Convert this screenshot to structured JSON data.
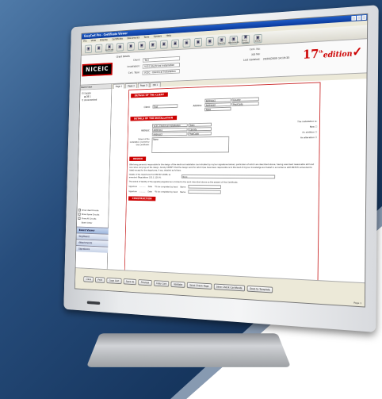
{
  "app": {
    "title": "EasyCert Pro - Certificate Viewer",
    "menu": [
      "File",
      "View",
      "Display",
      "Certificate",
      "Documents",
      "Tools",
      "System",
      "Help"
    ],
    "toolbar": [
      {
        "label": "",
        "icon": "new-icon"
      },
      {
        "label": "",
        "icon": "open-icon"
      },
      {
        "label": "Certificate",
        "icon": "certificate-icon"
      },
      {
        "label": "",
        "icon": "print-icon"
      },
      {
        "label": "",
        "icon": "copy-icon"
      },
      {
        "label": "",
        "icon": "paste-icon"
      },
      {
        "label": "",
        "icon": "doc-icon"
      },
      {
        "label": "",
        "icon": "doc-icon"
      },
      {
        "label": "",
        "icon": "doc-icon"
      },
      {
        "label": "",
        "icon": "doc-icon"
      },
      {
        "label": "",
        "icon": "doc-icon"
      },
      {
        "label": "",
        "icon": "doc-icon"
      },
      {
        "label": "Reports",
        "icon": "reports-icon"
      },
      {
        "label": "Attachments",
        "icon": "attachments-icon"
      },
      {
        "label": "Email Update",
        "icon": "email-icon"
      },
      {
        "label": "NICEIC",
        "icon": "niceic-icon"
      }
    ]
  },
  "header": {
    "logo": "NICEIC",
    "client_details_label": "Client Details",
    "client_label": "Client:",
    "client": "Test",
    "installation_label": "Installation:",
    "installation": "VCEC Electrical Installation",
    "cert_type_label": "Cert. Type:",
    "cert_type": "VCEC - Electrical Installation",
    "cert_no_label": "Cert. No:",
    "cert_no": "",
    "job_no_label": "Job No:",
    "job_no": "",
    "last_updated_label": "Last Updated:",
    "last_updated": "20/04/2009 14:19:35",
    "edition_num": "17",
    "edition_sup": "th",
    "edition_word": "edition"
  },
  "sidebar": {
    "title": "Board View",
    "tree": [
      "Supply",
      "DB 1",
      "Unconnected"
    ],
    "checks": [
      "Show Used Circuits",
      "Show Spare Circuits",
      "Show All Circuits",
      "Board Order"
    ],
    "nav": [
      "Board Viewer",
      "Key/Board",
      "Attachments",
      "Signatures"
    ]
  },
  "tabs": [
    "Page 1",
    "Page 2",
    "Page 3",
    "DB 1"
  ],
  "form": {
    "sec_client": "DETAILS OF THE CLIENT",
    "client_lbl": "Client:",
    "client_val": "Test",
    "address_lbl": "Address:",
    "addr1": "Address1",
    "addr2": "Address2",
    "town": "Town",
    "county": "County",
    "postcode": "PostCode",
    "sec_install": "DETAILS OF THE INSTALLATION",
    "i_address_lbl": "Address:",
    "i_val1": "VCEC Electrical Installation",
    "i_addr1": "Address1",
    "i_addr2": "Address2",
    "i_town": "Town",
    "i_county": "County",
    "i_postcode": "PostCode",
    "extent_lbl": "Extent of the installation covered by this Certificate:",
    "extent_val": "None",
    "install_is": "The installation is:",
    "new": "New",
    "addition": "An addition",
    "alteration": "An alteration",
    "sec_design": "DESIGN",
    "design_text": "I/We being person(s) responsible for the design of the electrical installation (as indicated by my/our signatures below), particulars of which are described above, having exercised reasonable skill and care when carrying out the design, hereby CERTIFY that the design work for which I/we have been responsible is to the best of my/our knowledge and belief in accordance with BS7671 amended to (date) except for the departures, if any, detailed as follows:",
    "departures_lbl": "Details of the departures from BS7671:2008, as amended (Regulations 120.3, 120.4):",
    "departures_val": "None",
    "extent_liab": "The extent of liability of the signatory/signatories is limited to the work described above as the subject of this Certificate.",
    "sig_lbl": "Signature",
    "date_lbl": "Date",
    "completed": "*To be completed by hand",
    "name_lbl": "Name",
    "sec_construction": "CONSTRUCTION"
  },
  "buttons": [
    "Close",
    "Print",
    "Copy Cert",
    "Save As",
    "Preview",
    "Copy Cert",
    "Validate",
    "Send Check Page",
    "Save Check Certificate",
    "Save to Template"
  ],
  "status": "Page 1"
}
